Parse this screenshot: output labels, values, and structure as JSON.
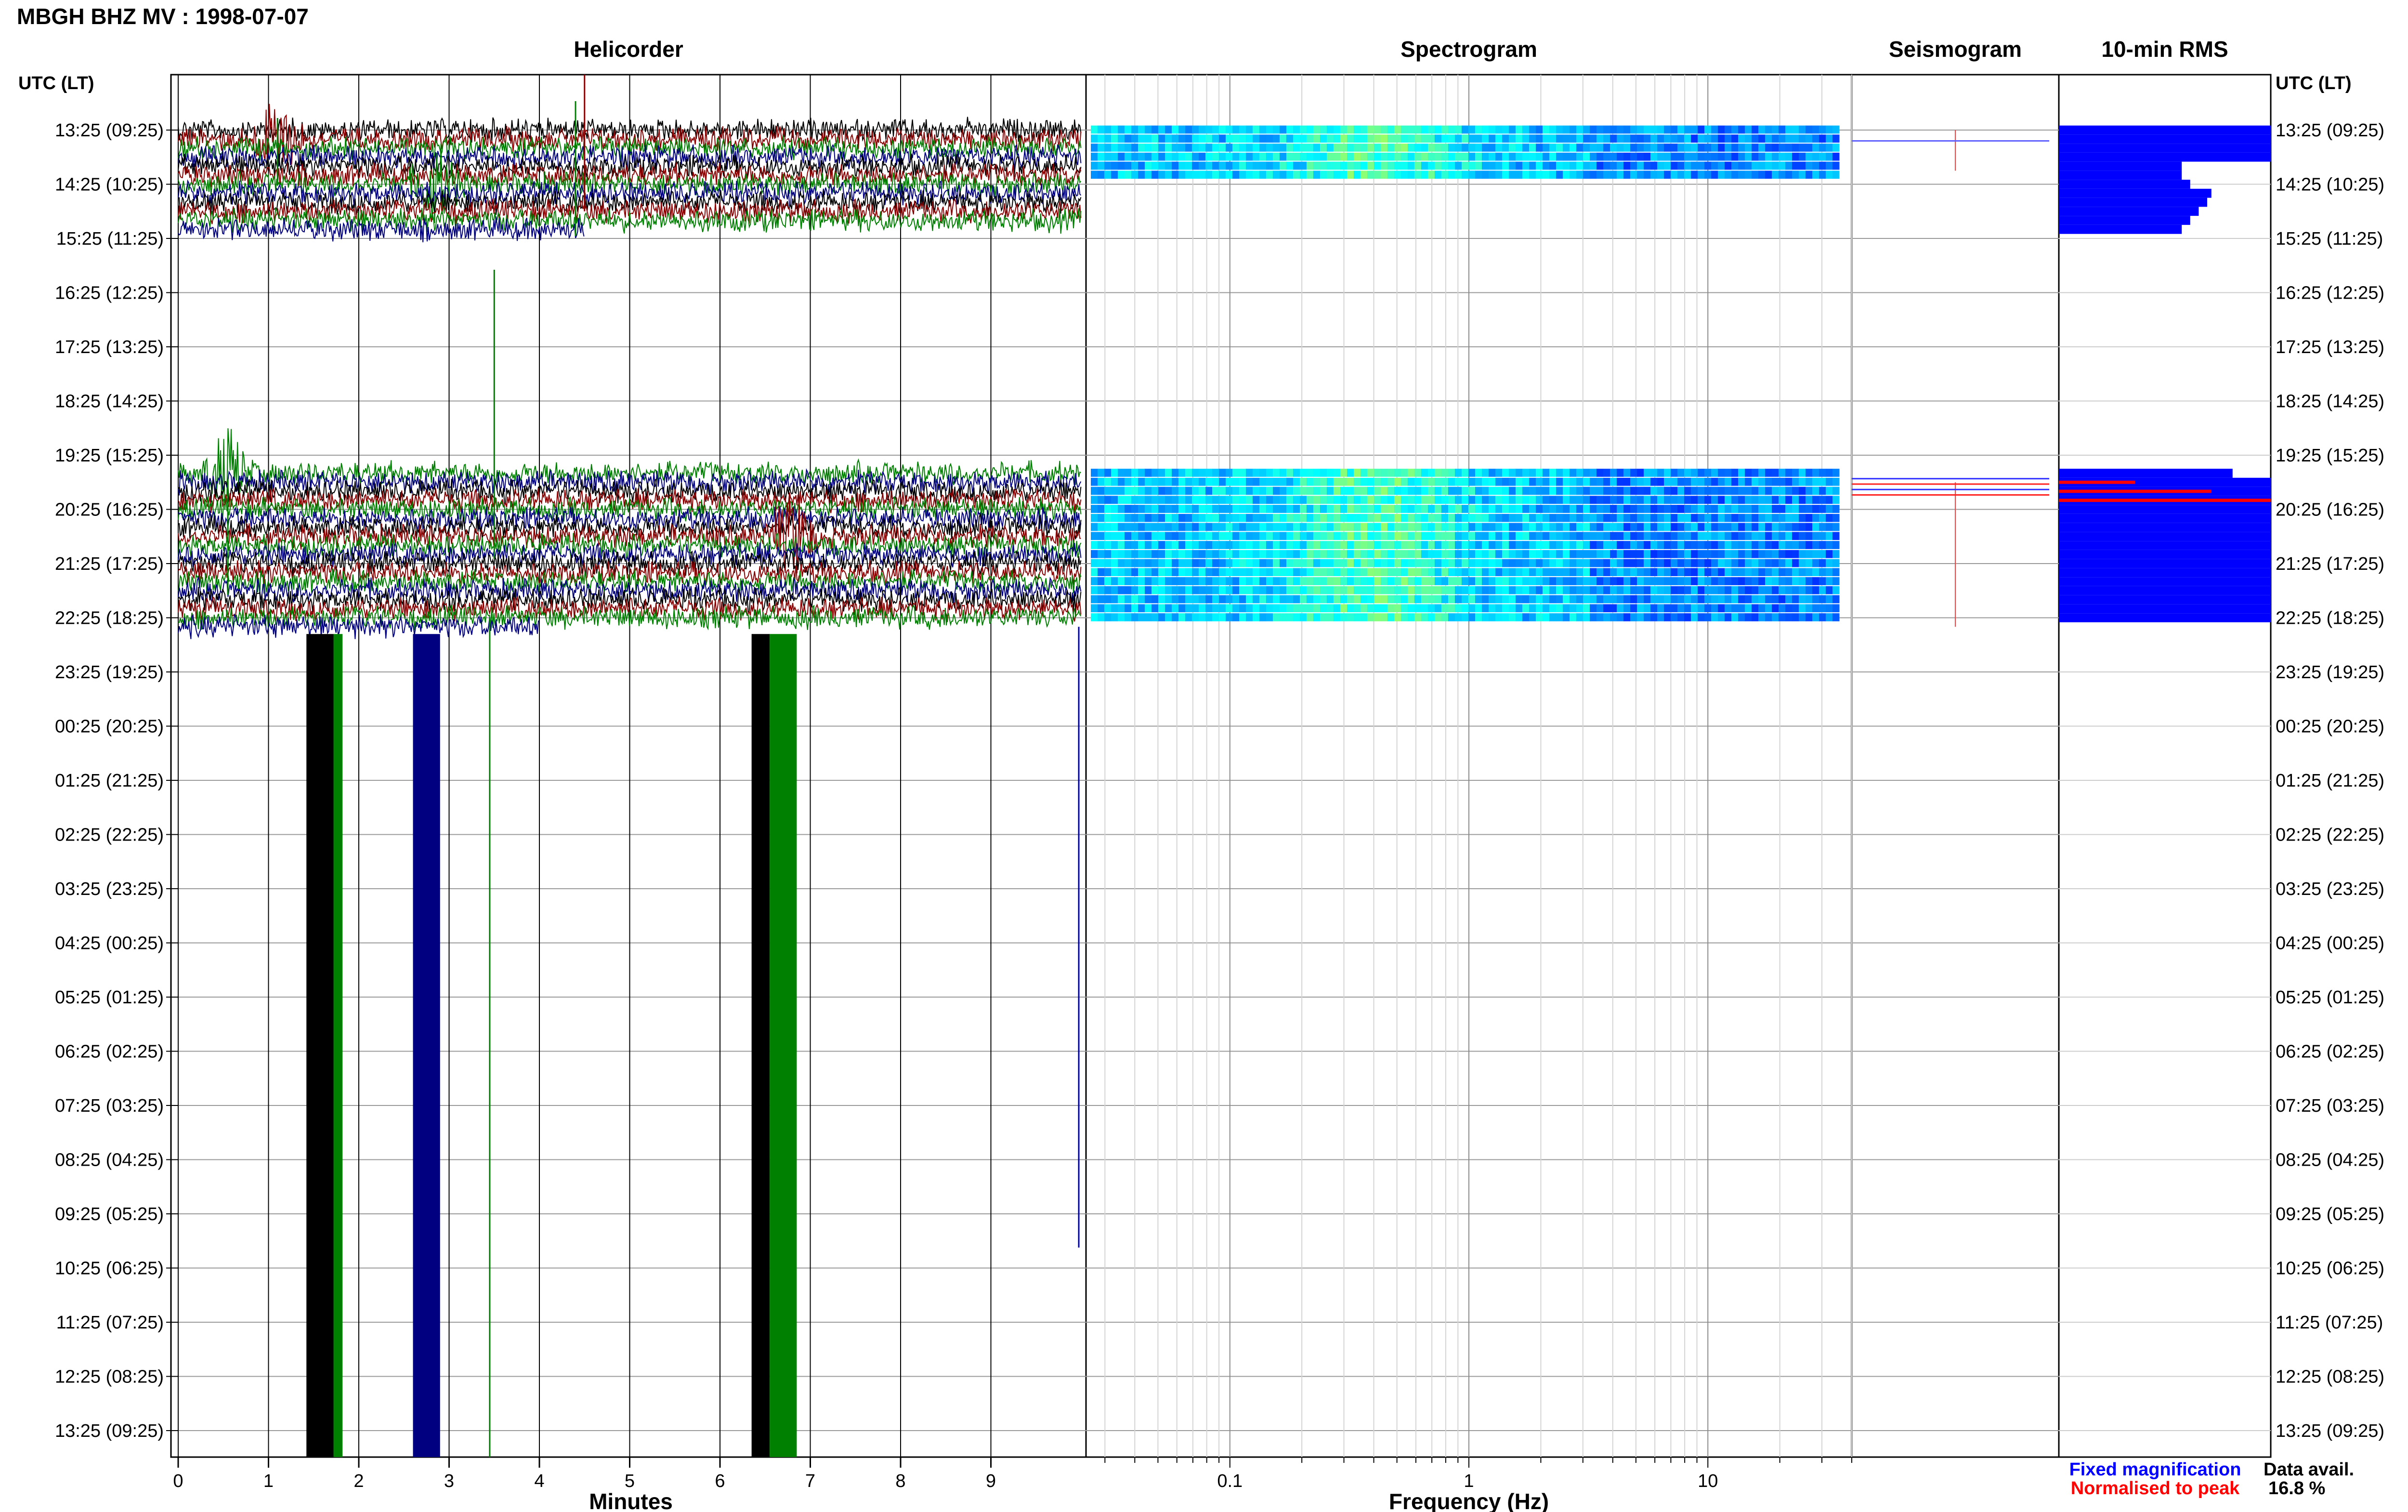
{
  "title": "MBGH BHZ MV : 1998-07-07",
  "time_axis_label": "UTC (LT)",
  "hour_labels": [
    "13:25 (09:25)",
    "14:25 (10:25)",
    "15:25 (11:25)",
    "16:25 (12:25)",
    "17:25 (13:25)",
    "18:25 (14:25)",
    "19:25 (15:25)",
    "20:25 (16:25)",
    "21:25 (17:25)",
    "22:25 (18:25)",
    "23:25 (19:25)",
    "00:25 (20:25)",
    "01:25 (21:25)",
    "02:25 (22:25)",
    "03:25 (23:25)",
    "04:25 (00:25)",
    "05:25 (01:25)",
    "06:25 (02:25)",
    "07:25 (03:25)",
    "08:25 (04:25)",
    "09:25 (05:25)",
    "10:25 (06:25)",
    "11:25 (07:25)",
    "12:25 (08:25)",
    "13:25 (09:25)"
  ],
  "legend": {
    "fixed": "Fixed magnification",
    "normalised": "Normalised to peak",
    "fixed_color": "#0000ff",
    "normalised_color": "#ff0000"
  },
  "data_availability": {
    "label": "Data avail.",
    "value": "16.8 %"
  },
  "trace_colors": [
    "#000000",
    "#8b0000",
    "#008000",
    "#000080"
  ],
  "chart_data": [
    {
      "type": "line",
      "panel": "helicorder",
      "title": "Helicorder",
      "xlabel": "Minutes",
      "xlim": [
        0,
        10
      ],
      "x_ticks": [
        "0",
        "1",
        "2",
        "3",
        "4",
        "5",
        "6",
        "7",
        "8",
        "9"
      ],
      "row_interval_minutes": 10,
      "hours_shown": 24,
      "data_segments_rows": [
        [
          0,
          11
        ],
        [
          38,
          55
        ]
      ],
      "notable_events": [
        {
          "row": 1,
          "minute": 1.1,
          "amplitude": "large"
        },
        {
          "row": 6,
          "minute": 2.85,
          "amplitude": "large"
        },
        {
          "row": 38,
          "minute": 0.55,
          "amplitude": "large"
        },
        {
          "row": 45,
          "minute": 6.8,
          "amplitude": "large"
        }
      ]
    },
    {
      "type": "heatmap",
      "panel": "spectrogram",
      "title": "Spectrogram",
      "xlabel": "Frequency (Hz)",
      "x_scale": "log",
      "xlim": [
        0.025,
        40
      ],
      "x_ticks": [
        "0.1",
        "1",
        "10"
      ],
      "colormap": "jet",
      "data_rows": [
        [
          0,
          5
        ],
        [
          38,
          54
        ]
      ]
    },
    {
      "type": "line",
      "panel": "seismogram",
      "title": "Seismogram"
    },
    {
      "type": "bar",
      "panel": "rms",
      "title": "10-min RMS",
      "orientation": "horizontal",
      "series": [
        {
          "name": "Fixed magnification",
          "color": "#0000ff",
          "rows": [
            0,
            1,
            2,
            3,
            4,
            5,
            6,
            7,
            8,
            9,
            10,
            11,
            38,
            39,
            40,
            41,
            42,
            43,
            44,
            45,
            46,
            47,
            48,
            49,
            50,
            51,
            52,
            53,
            54
          ],
          "values": [
            1.0,
            1.0,
            1.0,
            1.0,
            0.58,
            0.58,
            0.62,
            0.72,
            0.7,
            0.66,
            0.62,
            0.58,
            0.82,
            1.0,
            1.0,
            1.0,
            1.0,
            1.0,
            1.0,
            1.0,
            1.0,
            1.0,
            1.0,
            1.0,
            1.0,
            1.0,
            1.0,
            1.0,
            1.0
          ]
        },
        {
          "name": "Normalised to peak",
          "color": "#ff0000",
          "rows": [
            39,
            40,
            41
          ],
          "values": [
            0.36,
            0.72,
            1.0
          ]
        }
      ]
    }
  ]
}
